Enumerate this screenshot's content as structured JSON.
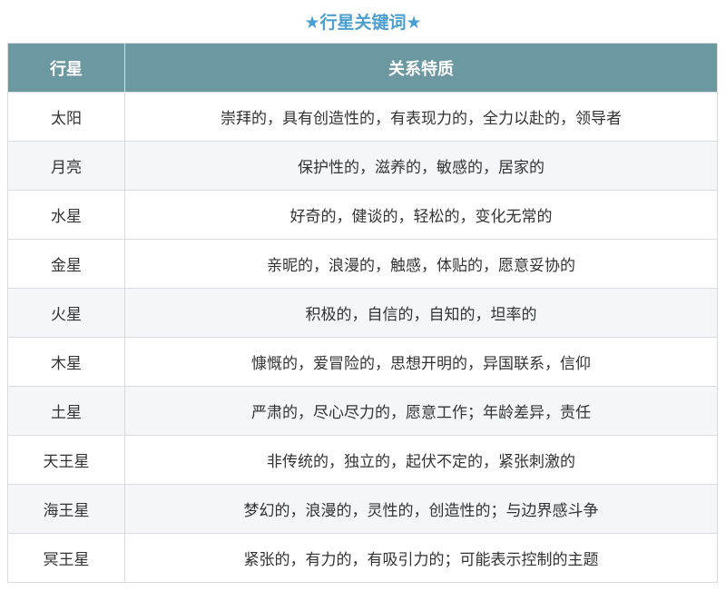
{
  "title": "★行星关键词★",
  "headers": {
    "planet": "行星",
    "traits": "关系特质"
  },
  "rows": [
    {
      "planet": "太阳",
      "traits": "崇拜的，具有创造性的，有表现力的，全力以赴的，领导者"
    },
    {
      "planet": "月亮",
      "traits": "保护性的，滋养的，敏感的，居家的"
    },
    {
      "planet": "水星",
      "traits": "好奇的，健谈的，轻松的，变化无常的"
    },
    {
      "planet": "金星",
      "traits": "亲昵的，浪漫的，触感，体贴的，愿意妥协的"
    },
    {
      "planet": "火星",
      "traits": "积极的，自信的，自知的，坦率的"
    },
    {
      "planet": "木星",
      "traits": "慷慨的，爱冒险的，思想开明的，异国联系，信仰"
    },
    {
      "planet": "土星",
      "traits": "严肃的，尽心尽力的，愿意工作；年龄差异，责任"
    },
    {
      "planet": "天王星",
      "traits": "非传统的，独立的，起伏不定的，紧张刺激的"
    },
    {
      "planet": "海王星",
      "traits": "梦幻的，浪漫的，灵性的，创造性的；与边界感斗争"
    },
    {
      "planet": "冥王星",
      "traits": "紧张的，有力的，有吸引力的；可能表示控制的主题"
    }
  ],
  "colors": {
    "title": "#4a9fd0",
    "header_bg": "#6c98a2",
    "header_text": "#ffffff",
    "row_tint": "#f3f7fa",
    "border": "#d8dcdf"
  }
}
